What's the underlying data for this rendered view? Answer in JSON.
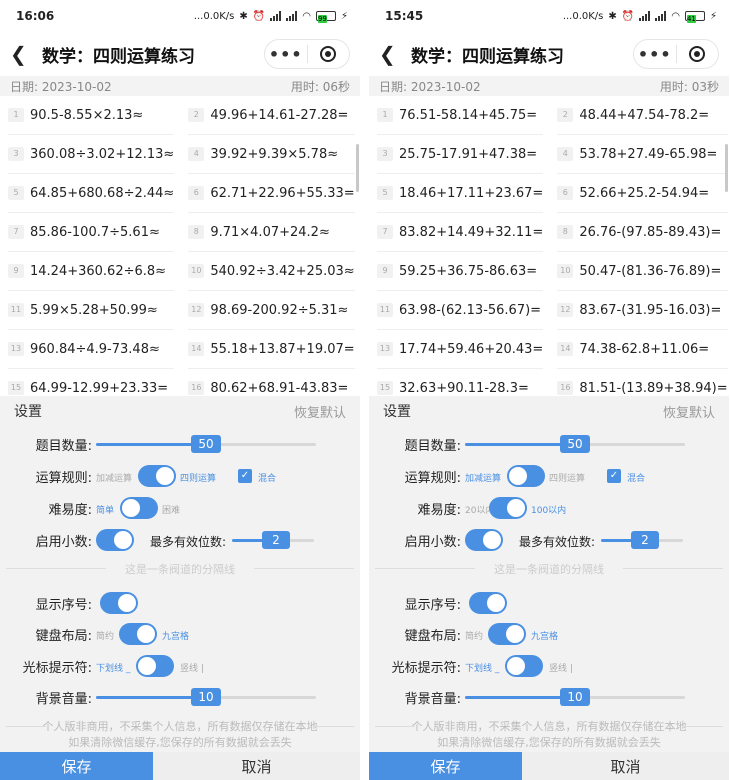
{
  "left": {
    "status": {
      "time": "16:06",
      "net": "...0.0K/s",
      "battery": "99"
    },
    "nav": {
      "title": "数学：四则运算练习",
      "more": "•••"
    },
    "info": {
      "date": "日期: 2023-10-02",
      "elapsed": "用时: 06秒"
    },
    "problems": [
      {
        "n": "1",
        "e": "90.5-8.55×2.13≈"
      },
      {
        "n": "2",
        "e": "49.96+14.61-27.28="
      },
      {
        "n": "3",
        "e": "360.08÷3.02+12.13≈"
      },
      {
        "n": "4",
        "e": "39.92+9.39×5.78≈"
      },
      {
        "n": "5",
        "e": "64.85+680.68÷2.44≈"
      },
      {
        "n": "6",
        "e": "62.71+22.96+55.33="
      },
      {
        "n": "7",
        "e": "85.86-100.7÷5.61≈"
      },
      {
        "n": "8",
        "e": "9.71×4.07+24.2≈"
      },
      {
        "n": "9",
        "e": "14.24+360.62÷6.8≈"
      },
      {
        "n": "10",
        "e": "540.92÷3.42+25.03≈"
      },
      {
        "n": "11",
        "e": "5.99×5.28+50.99≈"
      },
      {
        "n": "12",
        "e": "98.69-200.92÷5.31≈"
      },
      {
        "n": "13",
        "e": "960.84÷4.9-73.48≈"
      },
      {
        "n": "14",
        "e": "55.18+13.87+19.07="
      },
      {
        "n": "15",
        "e": "64.99-12.99+23.33="
      },
      {
        "n": "16",
        "e": "80.62+68.91-43.83="
      }
    ],
    "settings": {
      "title": "设置",
      "reset": "恢复默认",
      "count_label": "题目数量:",
      "count_value": "50",
      "count_fraction": 0.5,
      "rule_label": "运算规则:",
      "rule_off": "加减运算",
      "rule_on": "四则运算",
      "rule_state": "on",
      "mixed": "混合",
      "mixed_checked": true,
      "diff_label": "难易度:",
      "diff_a": "简单",
      "diff_b": "困难",
      "diff_state": "off",
      "decimal_label": "启用小数:",
      "maxdigits_label": "最多有效位数:",
      "maxdigits_value": "2",
      "divider": "这是一条阀道的分隔线",
      "seq_label": "显示序号:",
      "kb_label": "键盘布局:",
      "kb_a": "简约",
      "kb_b": "九宫格",
      "kb_state": "on",
      "cursor_label": "光标提示符:",
      "cursor_a": "下划线 _",
      "cursor_b": "竖线 |",
      "cursor_state": "off",
      "volume_label": "背景音量:",
      "volume_value": "10",
      "volume_fraction": 0.5,
      "note1": "个人版非商用，不采集个人信息，所有数据仅存储在本地",
      "note2": "如果清除微信缓存,您保存的所有数据就会丢失"
    },
    "buttons": {
      "save": "保存",
      "cancel": "取消"
    }
  },
  "right": {
    "status": {
      "time": "15:45",
      "net": "...0.0K/s",
      "battery": "41"
    },
    "nav": {
      "title": "数学：四则运算练习",
      "more": "•••"
    },
    "info": {
      "date": "日期: 2023-10-02",
      "elapsed": "用时: 03秒"
    },
    "problems": [
      {
        "n": "1",
        "e": "76.51-58.14+45.75="
      },
      {
        "n": "2",
        "e": "48.44+47.54-78.2="
      },
      {
        "n": "3",
        "e": "25.75-17.91+47.38="
      },
      {
        "n": "4",
        "e": "53.78+27.49-65.98="
      },
      {
        "n": "5",
        "e": "18.46+17.11+23.67="
      },
      {
        "n": "6",
        "e": "52.66+25.2-54.94="
      },
      {
        "n": "7",
        "e": "83.82+14.49+32.11="
      },
      {
        "n": "8",
        "e": "26.76-(97.85-89.43)="
      },
      {
        "n": "9",
        "e": "59.25+36.75-86.63="
      },
      {
        "n": "10",
        "e": "50.47-(81.36-76.89)="
      },
      {
        "n": "11",
        "e": "63.98-(62.13-56.67)="
      },
      {
        "n": "12",
        "e": "83.67-(31.95-16.03)="
      },
      {
        "n": "13",
        "e": "17.74+59.46+20.43="
      },
      {
        "n": "14",
        "e": "74.38-62.8+11.06="
      },
      {
        "n": "15",
        "e": "32.63+90.11-28.3="
      },
      {
        "n": "16",
        "e": "81.51-(13.89+38.94)="
      }
    ],
    "settings": {
      "title": "设置",
      "reset": "恢复默认",
      "count_label": "题目数量:",
      "count_value": "50",
      "count_fraction": 0.5,
      "rule_label": "运算规则:",
      "rule_off": "加减运算",
      "rule_on": "四则运算",
      "rule_state": "off",
      "mixed": "混合",
      "mixed_checked": true,
      "diff_label": "难易度:",
      "diff_a": "20以内",
      "diff_b": "100以内",
      "diff_state": "on",
      "decimal_label": "启用小数:",
      "maxdigits_label": "最多有效位数:",
      "maxdigits_value": "2",
      "divider": "这是一条阀道的分隔线",
      "seq_label": "显示序号:",
      "kb_label": "键盘布局:",
      "kb_a": "简约",
      "kb_b": "九宫格",
      "kb_state": "on",
      "cursor_label": "光标提示符:",
      "cursor_a": "下划线 _",
      "cursor_b": "竖线 |",
      "cursor_state": "off",
      "volume_label": "背景音量:",
      "volume_value": "10",
      "volume_fraction": 0.5,
      "note1": "个人版非商用，不采集个人信息，所有数据仅存储在本地",
      "note2": "如果清除微信缓存,您保存的所有数据就会丢失"
    },
    "buttons": {
      "save": "保存",
      "cancel": "取消"
    }
  }
}
